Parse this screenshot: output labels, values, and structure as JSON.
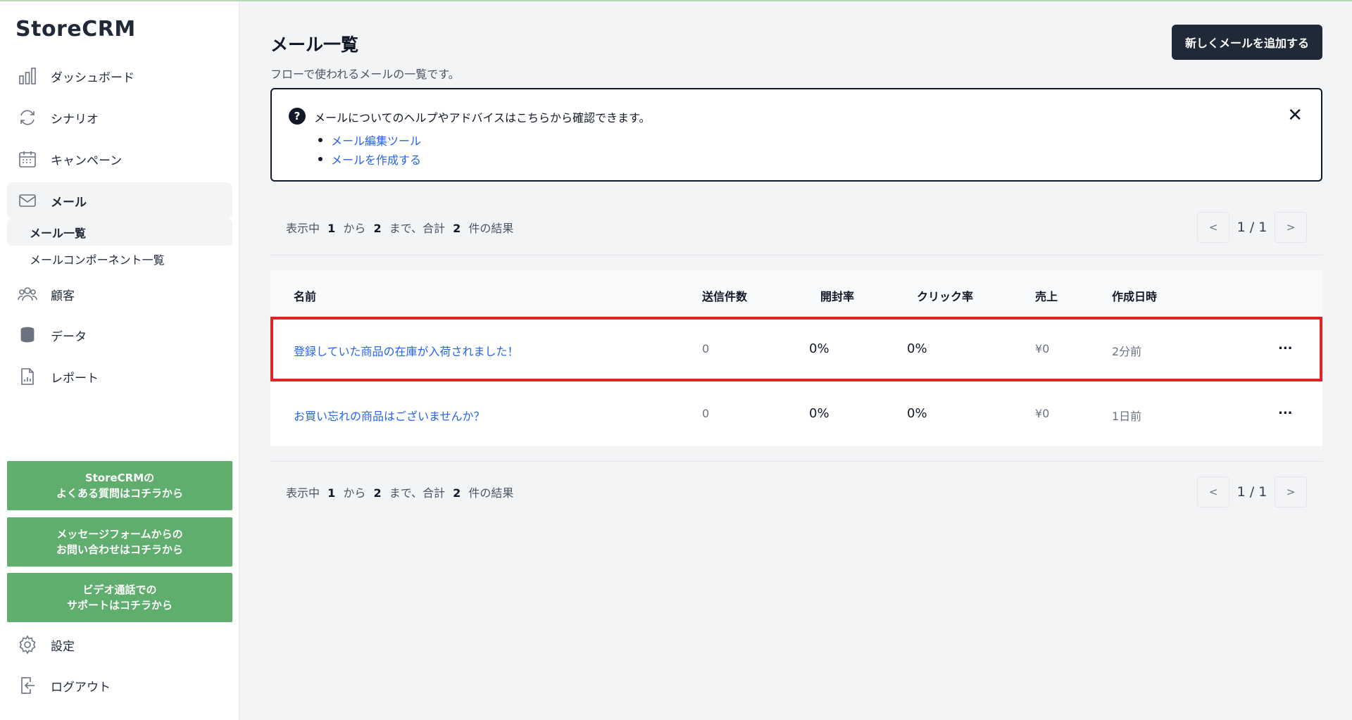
{
  "sidebar": {
    "brand": "StoreCRM",
    "nav": [
      {
        "label": "ダッシュボード",
        "icon": "bar-chart-icon"
      },
      {
        "label": "シナリオ",
        "icon": "refresh-icon"
      },
      {
        "label": "キャンペーン",
        "icon": "calendar-icon"
      },
      {
        "label": "メール",
        "icon": "mail-icon"
      },
      {
        "label": "顧客",
        "icon": "users-icon"
      },
      {
        "label": "データ",
        "icon": "database-icon"
      },
      {
        "label": "レポート",
        "icon": "report-icon"
      }
    ],
    "mail_sub": [
      {
        "label": "メール一覧"
      },
      {
        "label": "メールコンポーネント一覧"
      }
    ],
    "help_buttons": [
      {
        "line1": "StoreCRMの",
        "line2": "よくある質問はコチラから"
      },
      {
        "line1": "メッセージフォームからの",
        "line2": "お問い合わせはコチラから"
      },
      {
        "line1": "ビデオ通話での",
        "line2": "サポートはコチラから"
      }
    ],
    "settings_label": "設定",
    "logout_label": "ログアウト"
  },
  "main": {
    "title": "メール一覧",
    "description": "フローで使われるメールの一覧です。",
    "add_button": "新しくメールを追加する",
    "help": {
      "text": "メールについてのヘルプやアドバイスはこちらから確認できます。",
      "links": [
        "メール編集ツール",
        "メールを作成する"
      ],
      "close": "✕"
    },
    "results": {
      "prefix": "表示中",
      "from": "1",
      "from_label": "から",
      "to": "2",
      "to_label": "まで、合計",
      "total": "2",
      "suffix": "件の結果"
    },
    "pager": {
      "prev": "<",
      "page": "1 / 1",
      "next": ">"
    },
    "table": {
      "headers": [
        "名前",
        "送信件数",
        "開封率",
        "クリック率",
        "売上",
        "作成日時"
      ],
      "rows": [
        {
          "name": "登録していた商品の在庫が入荷されました！",
          "sent": "0",
          "open": "0%",
          "click": "0%",
          "sales": "¥0",
          "created": "2分前",
          "more": "..."
        },
        {
          "name": "お買い忘れの商品はございませんか？",
          "sent": "0",
          "open": "0%",
          "click": "0%",
          "sales": "¥0",
          "created": "1日前",
          "more": "..."
        }
      ]
    }
  },
  "colors": {
    "accent_green": "#5fae6e",
    "dark": "#1f2937",
    "link": "#2563eb",
    "highlight": "#e02424"
  }
}
